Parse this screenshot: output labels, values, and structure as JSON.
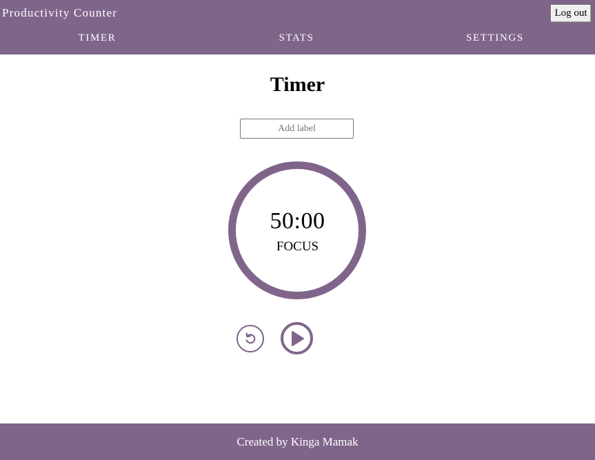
{
  "header": {
    "app_title": "Productivity Counter",
    "logout_label": "Log out",
    "nav": [
      {
        "label": "TIMER"
      },
      {
        "label": "STATS"
      },
      {
        "label": "SETTINGS"
      }
    ]
  },
  "main": {
    "title": "Timer",
    "label_input": {
      "value": "",
      "placeholder": "Add label"
    },
    "timer": {
      "time": "50:00",
      "mode": "FOCUS"
    },
    "controls": {
      "reset_icon": "reset-icon",
      "play_icon": "play-icon"
    }
  },
  "footer": {
    "text": "Created by Kinga Mamak"
  },
  "colors": {
    "accent": "#80658b",
    "background": "#ffffff",
    "text": "#000000"
  }
}
